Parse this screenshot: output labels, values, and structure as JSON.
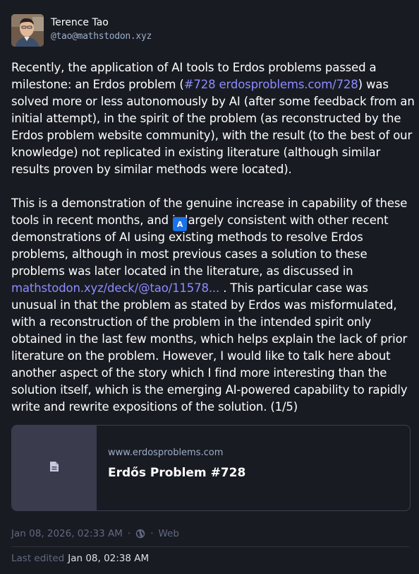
{
  "author": {
    "display_name": "Terence Tao",
    "handle": "@tao@mathstodon.xyz",
    "avatar": "avatar-photo"
  },
  "post": {
    "p1": {
      "t1": "Recently, the application of AI tools to Erdos problems passed a milestone: an Erdos problem (",
      "hashtag": "#728",
      "t2": " ",
      "link": "erdosproblems.com/728",
      "t3": ") was solved more or less autonomously by AI (after some feedback from an initial attempt), in the spirit of the problem (as reconstructed by the Erdos problem website community), with the result (to the best of our knowledge) not replicated in existing literature (although similar results proven by similar methods were located)."
    },
    "p2": {
      "t1": "This is a demonstration of the genuine increase in capability of these tools in recent months, and is largely consistent with other recent demonstrations of AI using existing methods to resolve Erdos problems, although in most previous cases a solution to these problems was later located in the literature, as discussed in ",
      "link": "mathstodon.xyz/deck/@tao/11578...",
      "t2": " .  This particular case was unusual in that the problem as stated by Erdos was misformulated, with a reconstruction of the problem in the intended spirit only obtained in the last few months, which helps explain the lack of prior literature on the problem. However, I would like to talk here about another aspect of the story which I find more interesting than the solution itself, which is the emerging AI-powered capability to rapidly write and rewrite expositions of the solution.  (1/5)"
    },
    "translate_icon": "translate-icon",
    "translate_glyph": "A"
  },
  "card": {
    "domain": "www.erdosproblems.com",
    "title": "Erdős Problem #728",
    "thumb_icon": "document-icon"
  },
  "meta": {
    "timestamp": "Jan 08, 2026, 02:33 AM",
    "separator": "·",
    "visibility_icon": "globe-icon",
    "application": "Web",
    "edited_label": "Last edited",
    "edited_time": "Jan 08, 02:38 AM"
  },
  "colors": {
    "background": "#191b22",
    "link": "#8c8dff",
    "muted": "#606984",
    "handle": "#9baec8",
    "card_thumb": "#3a3b4c"
  }
}
